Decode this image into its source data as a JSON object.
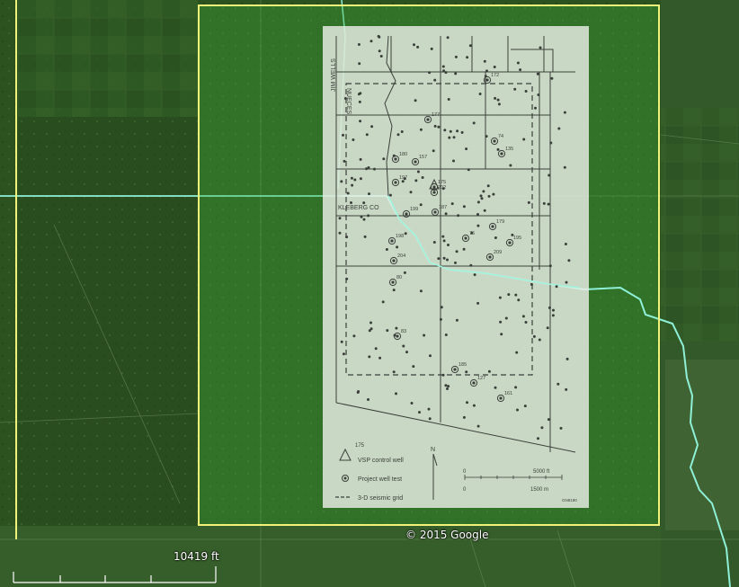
{
  "overlay": {
    "county_labels": {
      "jim_wells": "JIM WELLS",
      "nueces": "NUECES",
      "kleberg": "KLEBERG CO"
    },
    "wells": [
      {
        "id": "172",
        "label": "172"
      },
      {
        "id": "177",
        "label": "177"
      },
      {
        "id": "74",
        "label": "74"
      },
      {
        "id": "135",
        "label": "135"
      },
      {
        "id": "180",
        "label": "180"
      },
      {
        "id": "157",
        "label": "157"
      },
      {
        "id": "197",
        "label": "197"
      },
      {
        "id": "175",
        "label": "175"
      },
      {
        "id": "202",
        "label": "202"
      },
      {
        "id": "199",
        "label": "199"
      },
      {
        "id": "187",
        "label": "187"
      },
      {
        "id": "179",
        "label": "179"
      },
      {
        "id": "198",
        "label": "198"
      },
      {
        "id": "76",
        "label": "76"
      },
      {
        "id": "195",
        "label": "195"
      },
      {
        "id": "204",
        "label": "204"
      },
      {
        "id": "209",
        "label": "209"
      },
      {
        "id": "80",
        "label": "80"
      },
      {
        "id": "83",
        "label": "83"
      },
      {
        "id": "185",
        "label": "185"
      },
      {
        "id": "127",
        "label": "127"
      },
      {
        "id": "161",
        "label": "161"
      }
    ],
    "legend": {
      "vsp_number": "175",
      "vsp_label": "VSP control well",
      "project_label": "Project well test",
      "grid_label": "3-D seismic grid",
      "north": "N",
      "scale_ft": "5000 ft",
      "scale_m": "1500 m",
      "scale_zero_top": "0",
      "scale_zero_bottom": "0",
      "credit": "GN8190"
    }
  },
  "copyright": "© 2015 Google",
  "scale_bar": {
    "label": "10419 ft"
  },
  "colors": {
    "boundary": "#f2f27a",
    "overlay_tint": "#3fae3a",
    "river": "#8ff0d8",
    "paper": "#e6ece2",
    "ink": "#3a3f3a"
  }
}
